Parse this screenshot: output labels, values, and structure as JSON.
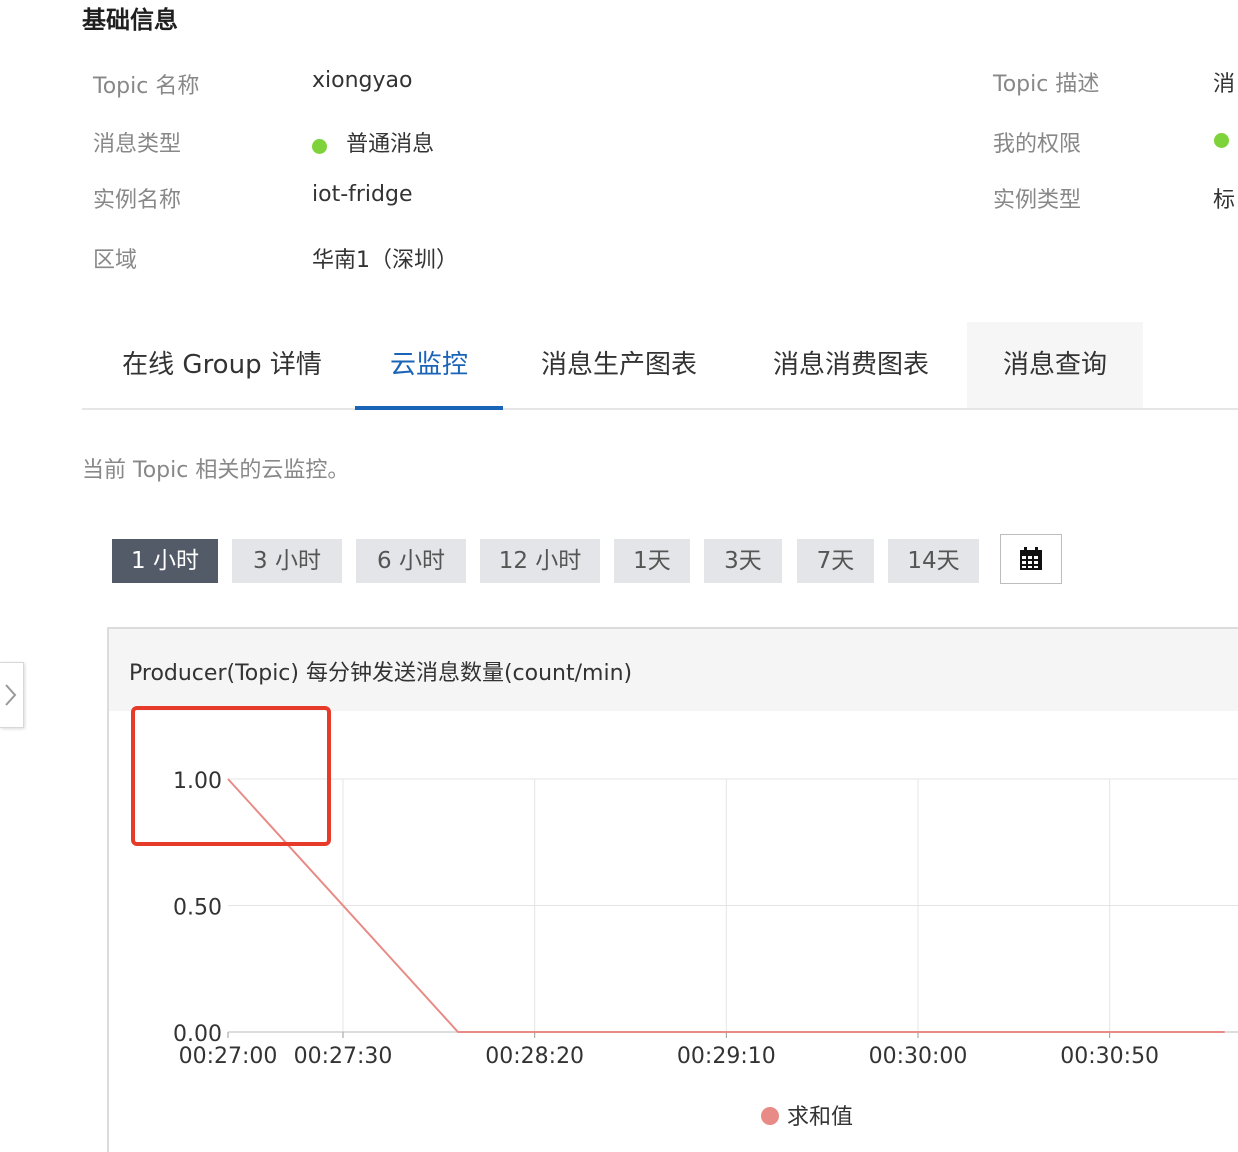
{
  "basic_info": {
    "title": "基础信息",
    "fields": [
      {
        "label": "Topic 名称",
        "value": "xiongyao"
      },
      {
        "label": "消息类型",
        "value": "普通消息"
      },
      {
        "label": "实例名称",
        "value": "iot-fridge"
      },
      {
        "label": "区域",
        "value": "华南1（深圳）"
      }
    ],
    "right_fields": [
      {
        "label": "Topic 描述",
        "value": "消"
      },
      {
        "label": "我的权限",
        "value": ""
      },
      {
        "label": "实例类型",
        "value": "标"
      }
    ],
    "status_color": "#7ed23a"
  },
  "tabs": [
    {
      "label": "在线 Group 详情"
    },
    {
      "label": "云监控",
      "active": true
    },
    {
      "label": "消息生产图表"
    },
    {
      "label": "消息消费图表"
    },
    {
      "label": "消息查询"
    }
  ],
  "description": "当前 Topic 相关的云监控。",
  "time_ranges": [
    "1 小时",
    "3 小时",
    "6 小时",
    "12 小时",
    "1天",
    "3天",
    "7天",
    "14天"
  ],
  "active_time_range": "1 小时",
  "calendar_icon": "calendar-icon",
  "colors": {
    "accent": "#1a64b8",
    "active_range": "#535b69",
    "series": "#e88b86",
    "highlight": "#e63a2a"
  },
  "chart_data": {
    "type": "line",
    "title": "Producer(Topic) 每分钟发送消息数量(count/min)",
    "x_ticks": [
      "00:27:00",
      "00:27:30",
      "00:28:20",
      "00:29:10",
      "00:30:00",
      "00:30:50"
    ],
    "y_ticks": [
      "0.00",
      "0.50",
      "1.00"
    ],
    "ylim": [
      0,
      1
    ],
    "series": [
      {
        "name": "求和值",
        "points": [
          [
            "00:27:00",
            1
          ],
          [
            "00:28:00",
            0
          ],
          [
            "00:31:20",
            0
          ]
        ]
      }
    ],
    "legend": "bottom-center",
    "grid": true
  }
}
